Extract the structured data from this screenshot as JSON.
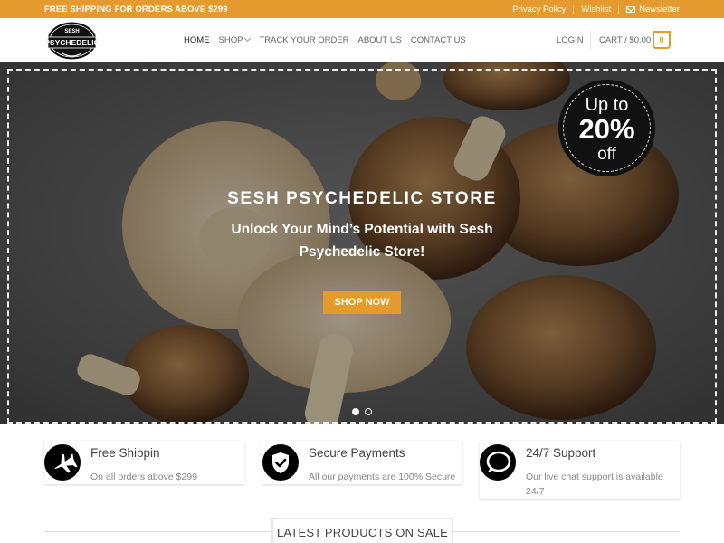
{
  "topbar": {
    "promo": "FREE SHIPPING FOR ORDERS ABOVE $299",
    "links": [
      "Privacy Policy",
      "Wishlist"
    ],
    "newsletter": "Newsletter"
  },
  "header": {
    "logo_text": [
      "SESH",
      "PSYCHEDELIC"
    ],
    "nav": [
      {
        "label": "HOME",
        "active": true
      },
      {
        "label": "SHOP",
        "dropdown": true
      },
      {
        "label": "TRACK YOUR ORDER"
      },
      {
        "label": "ABOUT US"
      },
      {
        "label": "CONTACT US"
      }
    ],
    "login": "LOGIN",
    "cart_label": "CART / $0.00",
    "cart_count": "0"
  },
  "hero": {
    "title": "SESH PSYCHEDELIC STORE",
    "subtitle": "Unlock Your Mind’s Potential with Sesh Psychedelic Store!",
    "button": "SHOP NOW",
    "badge": {
      "line1": "Up to",
      "line2": "20%",
      "line3": "off"
    },
    "slides": 2,
    "active_slide": 1
  },
  "features": [
    {
      "icon": "airplane-icon",
      "title": "Free Shippin",
      "desc": "On all orders above $299"
    },
    {
      "icon": "shield-check-icon",
      "title": "Secure Payments",
      "desc": "All our payments are 100% Secure"
    },
    {
      "icon": "chat-bubble-icon",
      "title": "24/7 Support",
      "desc": "Our live chat support is available 24/7"
    }
  ],
  "section": {
    "heading": "LATEST PRODUCTS ON SALE"
  },
  "colors": {
    "accent": "#e49a2c",
    "dark": "#111111"
  }
}
